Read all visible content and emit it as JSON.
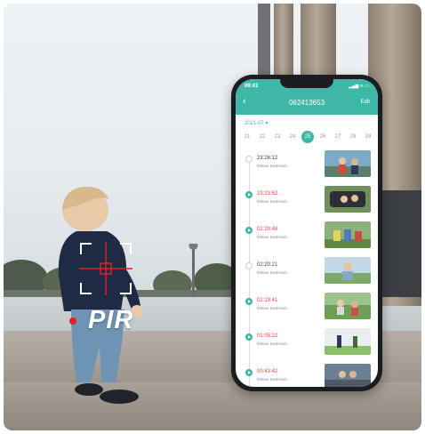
{
  "pir_label": "PIR",
  "phone": {
    "status_time": "09:41",
    "status_icons": "▂▄▆ ≋ ▭",
    "back_icon": "chevron-left-icon",
    "title": "062413653",
    "edit_label": "Edit",
    "month": "2021-07 ▾",
    "days": [
      "21",
      "22",
      "23",
      "24",
      "25",
      "26",
      "27",
      "28",
      "29"
    ],
    "active_day_index": 4,
    "events": [
      {
        "time": "23:26:12",
        "label": "Motion Detection",
        "highlight": false
      },
      {
        "time": "23:23:52",
        "label": "Motion Detection",
        "highlight": true
      },
      {
        "time": "02:20:48",
        "label": "Motion Detection",
        "highlight": true
      },
      {
        "time": "02:20:21",
        "label": "Motion Detection",
        "highlight": false
      },
      {
        "time": "02:19:41",
        "label": "Motion Detection",
        "highlight": true
      },
      {
        "time": "01:05:22",
        "label": "Motion Detection",
        "highlight": true
      },
      {
        "time": "00:43:42",
        "label": "Motion Detection",
        "highlight": true
      }
    ]
  },
  "colors": {
    "accent": "#3fb7a6",
    "alert": "#e8453c",
    "pir_dot": "#e4212b"
  }
}
